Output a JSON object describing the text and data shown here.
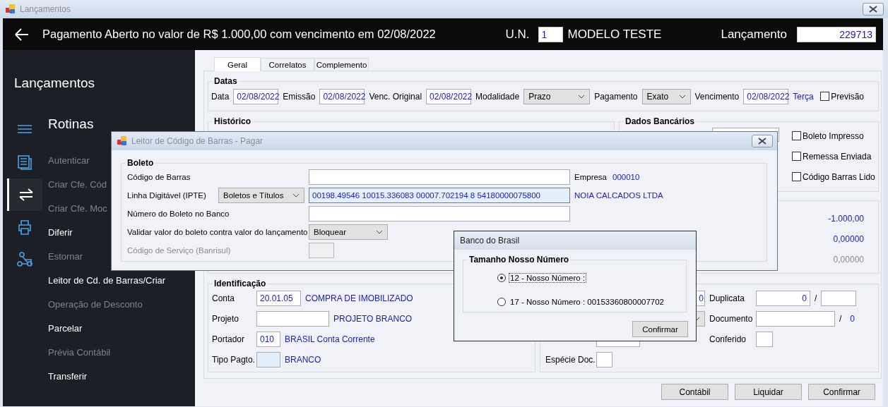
{
  "window": {
    "title": "Lançamentos"
  },
  "header": {
    "title": "Pagamento Aberto no valor de R$ 1.000,00 com vencimento em 02/08/2022",
    "unit_label": "U.N.",
    "unit_value": "1",
    "unit_name": "MODELO TESTE",
    "entry_label": "Lançamento",
    "entry_value": "229713"
  },
  "sidebar": {
    "title": "Lançamentos",
    "section": "Rotinas",
    "icons": [
      {
        "kind": "menu",
        "selected": false
      },
      {
        "kind": "document",
        "selected": false
      },
      {
        "kind": "transfer",
        "selected": true
      },
      {
        "kind": "printer",
        "selected": false
      },
      {
        "kind": "network",
        "selected": false
      }
    ],
    "items": [
      {
        "label": "Autenticar",
        "disabled": true
      },
      {
        "label": "Criar Cfe. Cód",
        "disabled": true
      },
      {
        "label": "Criar Cfe. Moc",
        "disabled": true
      },
      {
        "label": "Diferir",
        "disabled": false
      },
      {
        "label": "Estornar",
        "disabled": true
      },
      {
        "label": "Leitor de Cd. de Barras/Criar",
        "disabled": false
      },
      {
        "label": "Operação de Desconto",
        "disabled": true
      },
      {
        "label": "Parcelar",
        "disabled": false
      },
      {
        "label": "Prévia Contábil",
        "disabled": true
      },
      {
        "label": "Transferir",
        "disabled": false
      }
    ]
  },
  "tabs": [
    {
      "label": "Geral",
      "selected": true
    },
    {
      "label": "Correlatos",
      "selected": false
    },
    {
      "label": "Complemento",
      "selected": false
    }
  ],
  "dates": {
    "title": "Datas",
    "fields": [
      {
        "kind": "date",
        "label": "Data",
        "value": "02/08/2022"
      },
      {
        "kind": "date",
        "label": "Emissão",
        "value": "02/08/2022"
      },
      {
        "kind": "date",
        "label": "Venc. Original",
        "value": "02/08/2022"
      },
      {
        "kind": "select",
        "label": "Modalidade",
        "value": "Prazo"
      },
      {
        "kind": "select",
        "label": "Pagamento",
        "value": "Exato"
      },
      {
        "kind": "date",
        "label": "Vencimento",
        "value": "02/08/2022"
      }
    ],
    "weekday": "Terça",
    "forecast": {
      "label": "Previsão",
      "checked": false
    }
  },
  "history": {
    "title": "Histórico"
  },
  "bank_data": {
    "title": "Dados Bancários",
    "checkboxes": [
      {
        "label": "Boleto Impresso",
        "checked": false
      },
      {
        "label": "Remessa Enviada",
        "checked": false
      },
      {
        "label": "Código Barras Lido",
        "checked": false
      }
    ]
  },
  "totals": [
    {
      "value": "-1.000,00",
      "muted": false
    },
    {
      "value": "0,00000",
      "muted": false
    },
    {
      "value": "0,00000",
      "muted": true
    }
  ],
  "identification": {
    "title": "Identificação",
    "rows": [
      {
        "label": "Conta",
        "value": "20.01.05",
        "description": "COMPRA DE IMOBILIZADO",
        "focused": false
      },
      {
        "label": "Projeto",
        "description": "PROJETO BRANCO",
        "focused": false
      },
      {
        "label": "Portador",
        "value": "010",
        "description": "BRASIL Conta Corrente",
        "focused": false
      },
      {
        "label": "Tipo Pagto.",
        "description": "BRANCO",
        "focused": true
      }
    ]
  },
  "document": {
    "partial_value": "0",
    "duplicate_label": "Duplicata",
    "duplicate_value": "0",
    "duplicate_separator": "/",
    "document_label": "Documento",
    "document_separator": "/",
    "document_suffix": "0",
    "checked_label": "Conferido",
    "species_label": "Espécie Doc."
  },
  "buttons": [
    "Contábil",
    "Liquidar",
    "Confirmar"
  ],
  "barcode_dialog": {
    "title": "Leitor de Código de Barras - Pagar",
    "group": "Boleto",
    "rows": [
      {
        "kind": "text",
        "label": "Código de Barras",
        "disabled": false
      },
      {
        "kind": "ipte",
        "label": "Linha Digitável (IPTE)",
        "type": "Boletos e Títulos",
        "value": "00198.49546 10015.336083 00007.702194 8 54180000075800",
        "disabled": false
      },
      {
        "kind": "text",
        "label": "Número do Boleto no Banco",
        "disabled": false
      },
      {
        "kind": "select",
        "label": "Validar valor do boleto contra valor do lançamento",
        "option": "Bloquear",
        "disabled": false
      },
      {
        "kind": "text",
        "label": "Código de Serviço (Banrisul)",
        "disabled": true
      }
    ],
    "company_label": "Empresa",
    "company_code": "000010",
    "company_name": "NOIA CALCADOS LTDA"
  },
  "bank_dialog": {
    "title": "Banco do Brasil",
    "group": "Tamanho Nosso Número",
    "options": [
      {
        "label": "12 - Nosso Número :",
        "selected": true
      },
      {
        "label": "17 - Nosso Número : 00153360800007702",
        "selected": false
      }
    ],
    "button": "Confirmar"
  }
}
